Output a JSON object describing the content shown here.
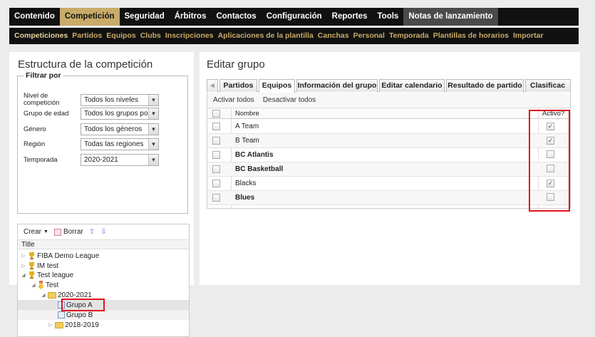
{
  "topnav": {
    "items": [
      "Contenido",
      "Competición",
      "Seguridad",
      "Árbitros",
      "Contactos",
      "Configuración",
      "Reportes",
      "Tools",
      "Notas de lanzamiento"
    ],
    "active_index": 1
  },
  "subnav": {
    "items": [
      "Competiciones",
      "Partidos",
      "Equipos",
      "Clubs",
      "Inscripciones",
      "Aplicaciones de la plantilla",
      "Canchas",
      "Personal",
      "Temporada",
      "Plantillas de horarios",
      "Importar"
    ],
    "active_index": 0
  },
  "left": {
    "title": "Estructura de la competición",
    "filter_legend": "Filtrar por",
    "filters": [
      {
        "label": "Nivel de competición",
        "value": "Todos los niveles"
      },
      {
        "label": "Grupo de edad",
        "value": "Todos los grupos por"
      },
      {
        "label": "Género",
        "value": "Todos los géneros"
      },
      {
        "label": "Región",
        "value": "Todas las regiones"
      },
      {
        "label": "Temporada",
        "value": "2020-2021"
      }
    ],
    "tree_toolbar": {
      "create": "Crear",
      "delete": "Borrar"
    },
    "tree_header": "Title",
    "tree": [
      "FIBA Demo League",
      "IM test",
      "Test league",
      "Test",
      "2020-2021",
      "Grupo A",
      "Grupo B",
      "2018-2019"
    ]
  },
  "right": {
    "title": "Editar grupo",
    "tabs": [
      "Partidos",
      "Equipos",
      "Información del grupo",
      "Editar calendario",
      "Resultado de partido",
      "Clasificac"
    ],
    "active_tab": 1,
    "grid_toolbar": {
      "activate_all": "Activar todos",
      "deactivate_all": "Desactivar todos"
    },
    "columns": {
      "name": "Nombre",
      "active": "Activo?"
    },
    "rows": [
      {
        "name": "A Team",
        "active": "✓",
        "bold": false
      },
      {
        "name": "B Team",
        "active": "✓",
        "bold": false
      },
      {
        "name": "BC Atlantis",
        "active": "",
        "bold": true
      },
      {
        "name": "BC Basketball",
        "active": "",
        "bold": true
      },
      {
        "name": "Blacks",
        "active": "✓",
        "bold": false
      },
      {
        "name": "Blues",
        "active": "",
        "bold": true
      }
    ]
  },
  "colors": {
    "accent": "#c9ab69",
    "nav_bg": "#111111",
    "highlight": "#e0141e"
  }
}
